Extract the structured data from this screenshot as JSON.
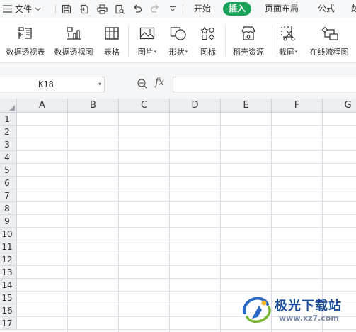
{
  "menubar": {
    "file_label": "文件",
    "tabs": [
      "开始",
      "插入",
      "页面布局",
      "公式"
    ],
    "active_tab": "插入",
    "overflow_tab_glyph": "数",
    "accent_color": "#1ba35a",
    "quick_access_icons": [
      "save-icon",
      "export-icon",
      "print-icon",
      "print-preview-icon",
      "undo-icon",
      "redo-icon",
      "more-icon"
    ]
  },
  "ribbon": {
    "items": [
      {
        "label": "数据透视表",
        "icon": "pivot-table-icon"
      },
      {
        "label": "数据透视图",
        "icon": "pivot-chart-icon"
      },
      {
        "label": "表格",
        "icon": "table-icon"
      },
      {
        "label": "图片",
        "icon": "picture-icon",
        "dropdown": true
      },
      {
        "label": "形状",
        "icon": "shape-icon",
        "dropdown": true
      },
      {
        "label": "图标",
        "icon": "icons-icon"
      },
      {
        "label": "稻壳资源",
        "icon": "docer-icon"
      },
      {
        "label": "截屏",
        "icon": "screenshot-icon",
        "dropdown": true
      },
      {
        "label": "在线流程图",
        "icon": "flowchart-icon"
      }
    ],
    "caret": "▾"
  },
  "formula_bar": {
    "cell_ref": "K18",
    "fx_label": "fx",
    "formula": ""
  },
  "sheet": {
    "columns": [
      "A",
      "B",
      "C",
      "D",
      "E",
      "F",
      "G"
    ],
    "rows": [
      "1",
      "2",
      "3",
      "4",
      "5",
      "6",
      "7",
      "8",
      "9",
      "10",
      "11",
      "12",
      "13",
      "14",
      "15",
      "16",
      "17"
    ]
  },
  "watermark": {
    "title": "极光下载站",
    "url": "www.xz7.com"
  }
}
